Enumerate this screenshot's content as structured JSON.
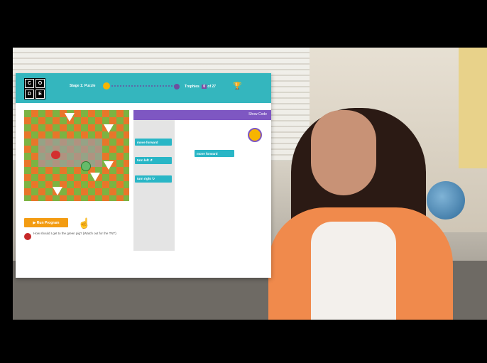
{
  "app": {
    "logo_letters": [
      "C",
      "O",
      "D",
      "E"
    ],
    "stage_title": "Stage 1: Puzzle",
    "trophies_label": "Trophies",
    "trophies_count": "0",
    "trophies_total": "of 27",
    "show_code": "Show Code",
    "run_program": "▶ Run Program",
    "instruction": "How should I get to the green pig? (Watch out for the TNT)",
    "blocks": {
      "toolbox": [
        "move forward",
        "turn left ↺",
        "turn right ↻"
      ],
      "workspace": [
        "move forward"
      ]
    }
  },
  "colors": {
    "topbar": "#34b6be",
    "run_button": "#f39c12",
    "block": "#29b6c6",
    "workspace_header": "#7e57c2"
  }
}
